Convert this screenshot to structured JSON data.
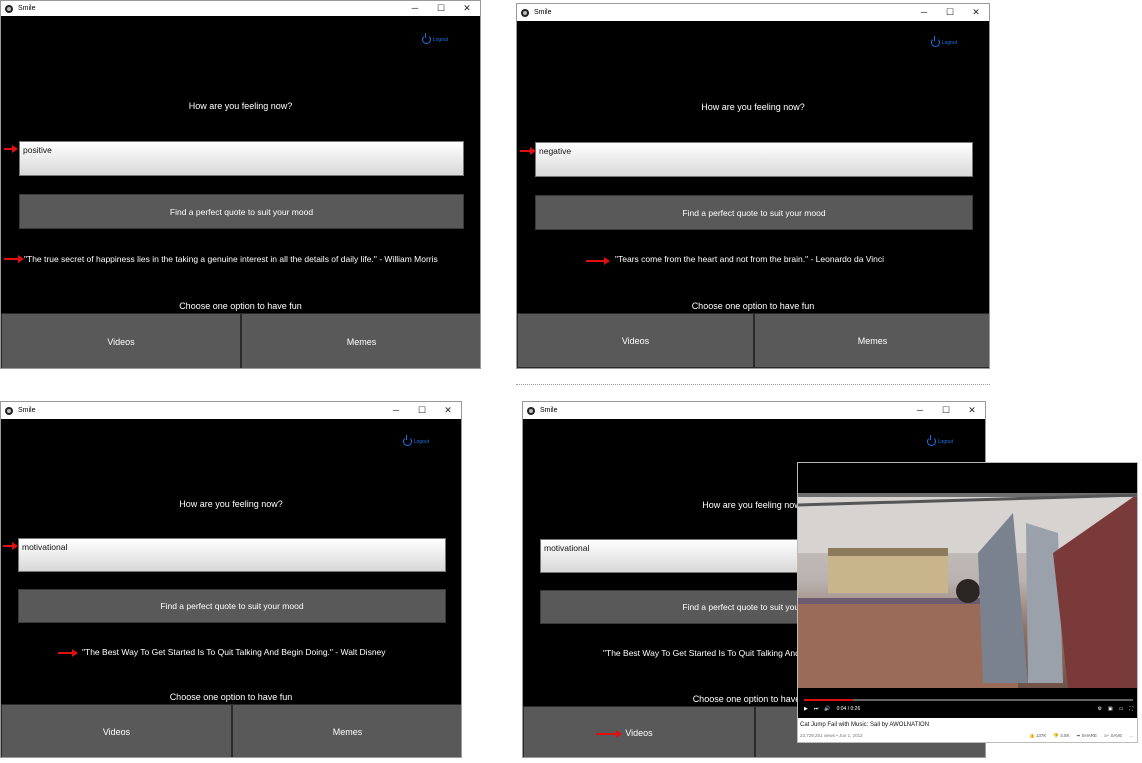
{
  "window_title": "Smile",
  "controls": {
    "minimize": "─",
    "maximize": "☐",
    "close": "✕"
  },
  "logout_label": "Logout",
  "question": "How are you feeling now?",
  "find_button": "Find a perfect quote to suit your mood",
  "choose_label": "Choose one option to have fun",
  "options": {
    "videos": "Videos",
    "memes": "Memes"
  },
  "panels": [
    {
      "mood": "positive",
      "quote": "\"The true secret of happiness lies in the taking a genuine interest in all the details of daily life.\" - William Morris"
    },
    {
      "mood": "negative",
      "quote": "\"Tears come from the heart and not from the brain.\" -  Leonardo da Vinci"
    },
    {
      "mood": "motivational",
      "quote": "\"The Best Way To Get Started Is To Quit Talking And Begin Doing.\" - Walt Disney"
    },
    {
      "mood": "motivational",
      "quote": "\"The Best Way To Get Started Is To Quit Talking And Begin Doing.\" - Walt Disney"
    }
  ],
  "video": {
    "time": "0:04 / 0:26",
    "progress": 0.15,
    "title": "Cat Jump Fail with Music: Sail by AWOLNATION",
    "meta": "23,729,251 views • Jun 1, 2012",
    "likes": "137K",
    "dislikes": "3.5K",
    "share": "SHARE",
    "save": "SAVE",
    "more": "..."
  },
  "colors": {
    "accent": "#1e73e8",
    "arrow": "#e01010",
    "button": "#595959"
  }
}
